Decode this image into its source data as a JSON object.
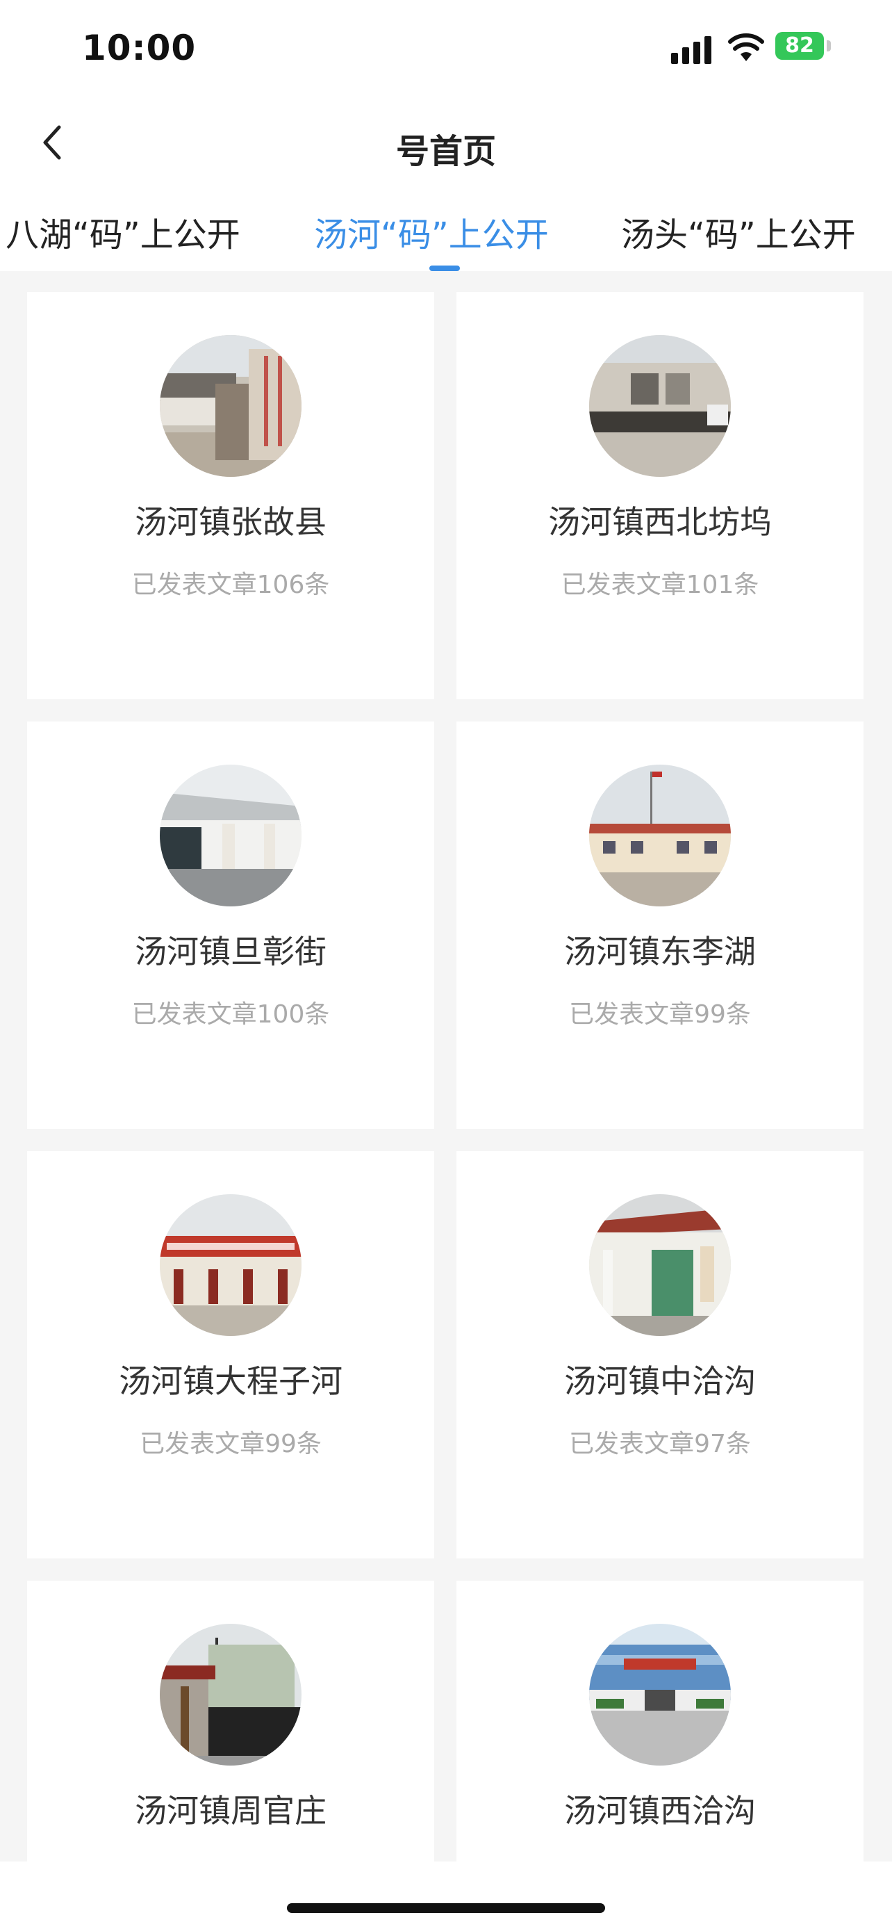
{
  "status_bar": {
    "time": "10:00",
    "battery": "82"
  },
  "nav": {
    "title": "号首页"
  },
  "tabs": [
    {
      "label": "八湖“码”上公开"
    },
    {
      "label": "汤河“码”上公开"
    },
    {
      "label": "汤头“码”上公开"
    }
  ],
  "cards": [
    {
      "title": "汤河镇张故县",
      "subtitle": "已发表文章106条"
    },
    {
      "title": "汤河镇西北坊坞",
      "subtitle": "已发表文章101条"
    },
    {
      "title": "汤河镇旦彰街",
      "subtitle": "已发表文章100条"
    },
    {
      "title": "汤河镇东李湖",
      "subtitle": "已发表文章99条"
    },
    {
      "title": "汤河镇大程子河",
      "subtitle": "已发表文章99条"
    },
    {
      "title": "汤河镇中洽沟",
      "subtitle": "已发表文章97条"
    },
    {
      "title": "汤河镇周官庄",
      "subtitle": ""
    },
    {
      "title": "汤河镇西洽沟",
      "subtitle": ""
    }
  ],
  "colors": {
    "accent": "#3a8ee6",
    "battery": "#34c759"
  }
}
